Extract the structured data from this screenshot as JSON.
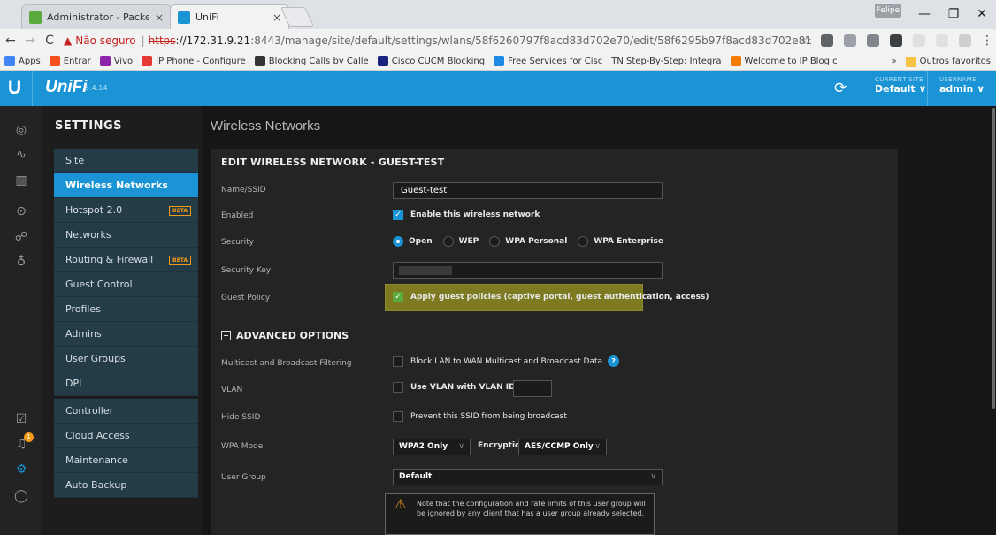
{
  "browser": {
    "tabs": [
      {
        "title": "Administrator - PacketFe",
        "close": "×"
      },
      {
        "title": "UniFi",
        "close": "×"
      }
    ],
    "profile": "Felipe",
    "window_controls": [
      "—",
      "❐",
      "✕"
    ],
    "url": {
      "warning_label": "Não seguro",
      "scheme": "https",
      "host": "://172.31.9.21",
      "path": ":8443/manage/site/default/settings/wlans/58f6260797f8acd83d702e70/edit/58f6295b97f8acd83d702e81"
    },
    "bookmarks": [
      {
        "label": "Apps",
        "color": "#4285f4"
      },
      {
        "label": "Entrar",
        "color": "#f4511e"
      },
      {
        "label": "Vivo",
        "color": "#8e24aa"
      },
      {
        "label": "IP Phone - Configure",
        "color": "#e53935"
      },
      {
        "label": "Blocking Calls by Calle",
        "color": "#333333"
      },
      {
        "label": "Cisco CUCM Blocking",
        "color": "#1a237e"
      },
      {
        "label": "Free Services for Cisc",
        "color": "#1e88e5"
      },
      {
        "label": "TN Step-By-Step: Integra",
        "color": "#999999"
      },
      {
        "label": "Welcome to IP Blog c",
        "color": "#f57c00"
      }
    ],
    "bookmarks_more": "»",
    "other_bookmarks": "Outros favoritos"
  },
  "header": {
    "brand": "UniFi",
    "version": "5.4.14",
    "current_site_label": "CURRENT SITE",
    "current_site_value": "Default",
    "username_label": "USERNAME",
    "username_value": "admin"
  },
  "sidebar": {
    "title": "SETTINGS",
    "items": [
      {
        "label": "Site"
      },
      {
        "label": "Wireless Networks"
      },
      {
        "label": "Hotspot 2.0",
        "badge": "BETA"
      },
      {
        "label": "Networks"
      },
      {
        "label": "Routing & Firewall",
        "badge": "BETA"
      },
      {
        "label": "Guest Control"
      },
      {
        "label": "Profiles"
      },
      {
        "label": "Admins"
      },
      {
        "label": "User Groups"
      },
      {
        "label": "DPI"
      },
      {
        "label": "Controller"
      },
      {
        "label": "Cloud Access"
      },
      {
        "label": "Maintenance"
      },
      {
        "label": "Auto Backup"
      }
    ]
  },
  "main": {
    "page_title": "Wireless Networks",
    "section_title": "EDIT WIRELESS NETWORK - GUEST-TEST",
    "fields": {
      "name_label": "Name/SSID",
      "name_value": "Guest-test",
      "enabled_label": "Enabled",
      "enabled_text": "Enable this wireless network",
      "security_label": "Security",
      "security_options": [
        "Open",
        "WEP",
        "WPA Personal",
        "WPA Enterprise"
      ],
      "security_key_label": "Security Key",
      "guest_policy_label": "Guest Policy",
      "guest_policy_text": "Apply guest policies (captive portal, guest authentication, access)"
    },
    "advanced": {
      "title": "ADVANCED OPTIONS",
      "multicast_label": "Multicast and Broadcast Filtering",
      "multicast_text": "Block LAN to WAN Multicast and Broadcast Data",
      "vlan_label": "VLAN",
      "vlan_text": "Use VLAN  with VLAN ID",
      "hide_ssid_label": "Hide SSID",
      "hide_ssid_text": "Prevent this SSID from being broadcast",
      "wpa_mode_label": "WPA Mode",
      "wpa_mode_value": "WPA2 Only",
      "encryption_label": "Encryption",
      "encryption_value": "AES/CCMP Only",
      "user_group_label": "User Group",
      "user_group_value": "Default",
      "note": "Note that the configuration and rate limits of this user group will be ignored by any client that has a user group already selected."
    }
  }
}
